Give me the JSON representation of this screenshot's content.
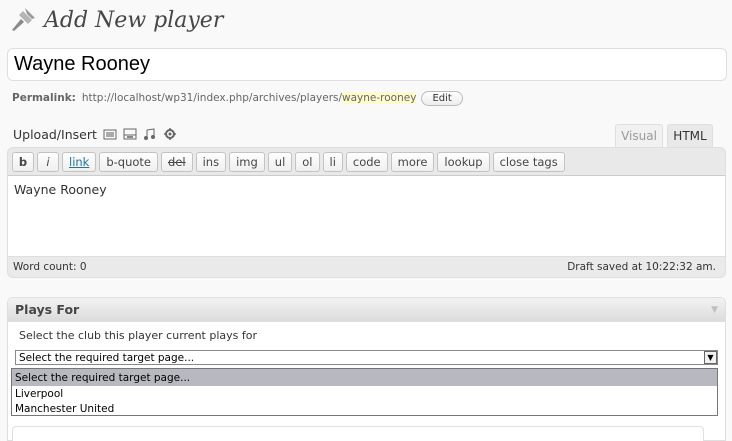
{
  "header": {
    "title": "Add New player",
    "icon": "pushpin-icon"
  },
  "post_title": {
    "value": "Wayne Rooney"
  },
  "permalink": {
    "label": "Permalink:",
    "base": "http://localhost/wp31/index.php/archives/players/",
    "slug": "wayne-rooney",
    "edit_label": "Edit"
  },
  "upload": {
    "label": "Upload/Insert",
    "icons": [
      "image-icon",
      "video-icon",
      "audio-icon",
      "media-icon"
    ]
  },
  "editor_tabs": [
    "Visual",
    "HTML"
  ],
  "active_tab": "HTML",
  "quicktags": [
    "b",
    "i",
    "link",
    "b-quote",
    "del",
    "ins",
    "img",
    "ul",
    "ol",
    "li",
    "code",
    "more",
    "lookup",
    "close tags"
  ],
  "editor": {
    "content": "Wayne Rooney"
  },
  "status": {
    "word_count": "Word count: 0",
    "draft_saved": "Draft saved at 10:22:32 am."
  },
  "plays_for": {
    "title": "Plays For",
    "description": "Select the club this player current plays for",
    "selected": "Select the required target page...",
    "options": [
      "Select the required target page...",
      "Liverpool",
      "Manchester United"
    ]
  },
  "colors": {
    "accent_link": "#21759b",
    "slug_highlight": "#fffbcc",
    "dropdown_highlight": "#b8b8c0"
  }
}
